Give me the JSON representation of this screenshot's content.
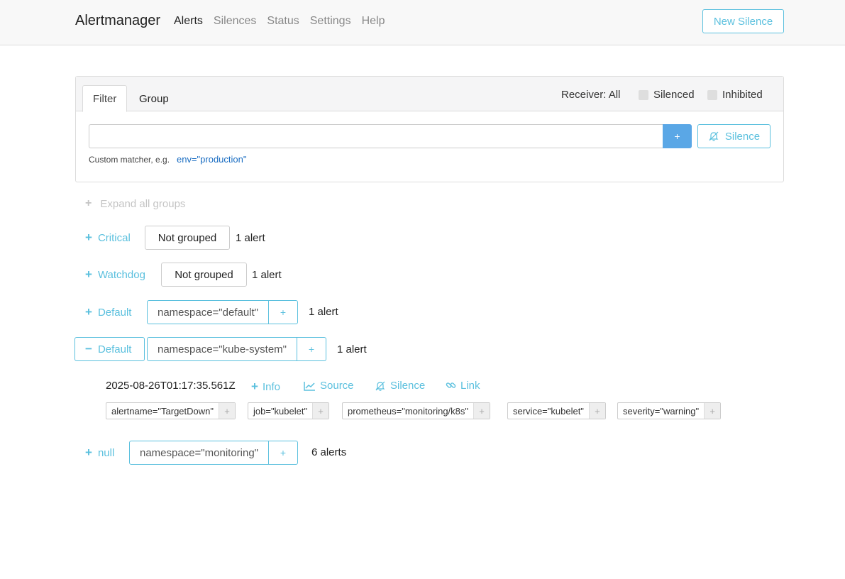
{
  "navbar": {
    "brand": "Alertmanager",
    "links": [
      "Alerts",
      "Silences",
      "Status",
      "Settings",
      "Help"
    ],
    "new_silence": "New Silence"
  },
  "filter_card": {
    "tabs": [
      "Filter",
      "Group"
    ],
    "receiver": "Receiver: All",
    "silenced_label": "Silenced",
    "inhibited_label": "Inhibited",
    "input_value": "",
    "add_button": "+",
    "silence_button": "Silence",
    "hint": "Custom matcher, e.g.",
    "hint_example": "env=\"production\""
  },
  "expand_all": "Expand all groups",
  "groups": [
    {
      "receiver": "Critical",
      "label": "Not grouped",
      "count": "1 alert"
    },
    {
      "receiver": "Watchdog",
      "label": "Not grouped",
      "count": "1 alert"
    },
    {
      "receiver": "Default",
      "label": "namespace=\"default\"",
      "add": "+",
      "count": "1 alert"
    },
    {
      "receiver": "Default",
      "label": "namespace=\"kube-system\"",
      "add": "+",
      "count": "1 alert"
    },
    {
      "receiver": "null",
      "label": "namespace=\"monitoring\"",
      "add": "+",
      "count": "6 alerts"
    }
  ],
  "alert": {
    "time": "2025-08-26T01:17:35.561Z",
    "actions": [
      "Info",
      "Source",
      "Silence",
      "Link"
    ],
    "labels": [
      "alertname=\"TargetDown\"",
      "job=\"kubelet\"",
      "prometheus=\"monitoring/k8s\"",
      "service=\"kubelet\"",
      "severity=\"warning\""
    ],
    "label_add": "+"
  },
  "colors": {
    "accent": "#5bc0de",
    "primary": "#5aa7e6",
    "link": "#1a6dc2"
  }
}
